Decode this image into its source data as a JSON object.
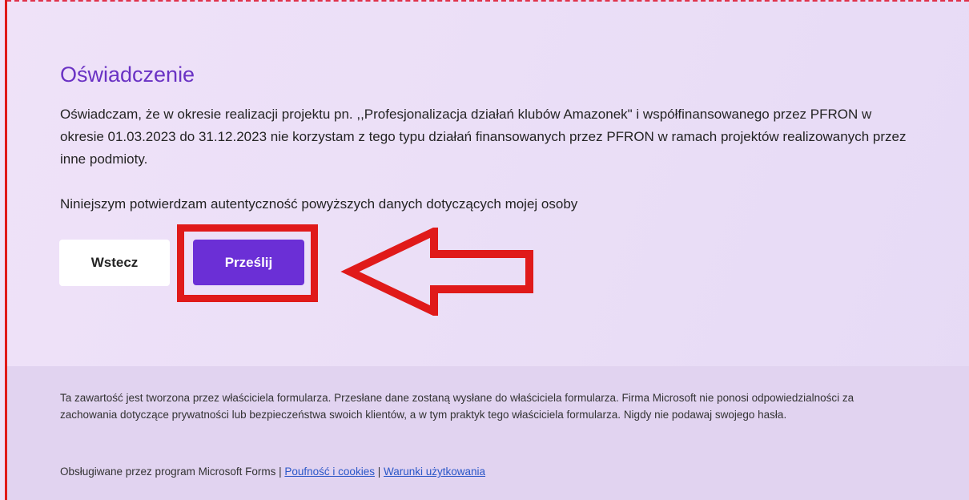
{
  "form": {
    "title": "Oświadczenie",
    "statement": "Oświadczam, że w okresie realizacji projektu pn. ,,Profesjonalizacja działań klubów Amazonek\" i  współfinansowanego przez PFRON w okresie 01.03.2023 do 31.12.2023  nie korzystam z tego typu działań finansowanych przez PFRON w ramach projektów realizowanych przez inne podmioty.",
    "confirmation": "Niniejszym potwierdzam autentyczność powyższych  danych dotyczących mojej osoby",
    "back_label": "Wstecz",
    "submit_label": "Prześlij"
  },
  "annotation": {
    "highlight_color": "#e01a1a",
    "arrow_color": "#e01a1a",
    "arrow_icon": "arrow-left-outline-icon"
  },
  "footer": {
    "disclaimer": "Ta zawartość jest tworzona przez właściciela formularza. Przesłane dane zostaną wysłane do właściciela formularza. Firma Microsoft nie ponosi odpowiedzialności za zachowania dotyczące prywatności lub bezpieczeństwa swoich klientów, a w tym praktyk tego właściciela formularza. Nigdy nie podawaj swojego hasła.",
    "powered_by": "Obsługiwane przez program Microsoft Forms",
    "separator": "|",
    "privacy_link": "Poufność i cookies",
    "terms_link": "Warunki użytkowania"
  },
  "colors": {
    "accent": "#6b2fd6",
    "title": "#6a32c4",
    "link": "#2b57c8",
    "footer_bg": "#e1d3f0"
  }
}
